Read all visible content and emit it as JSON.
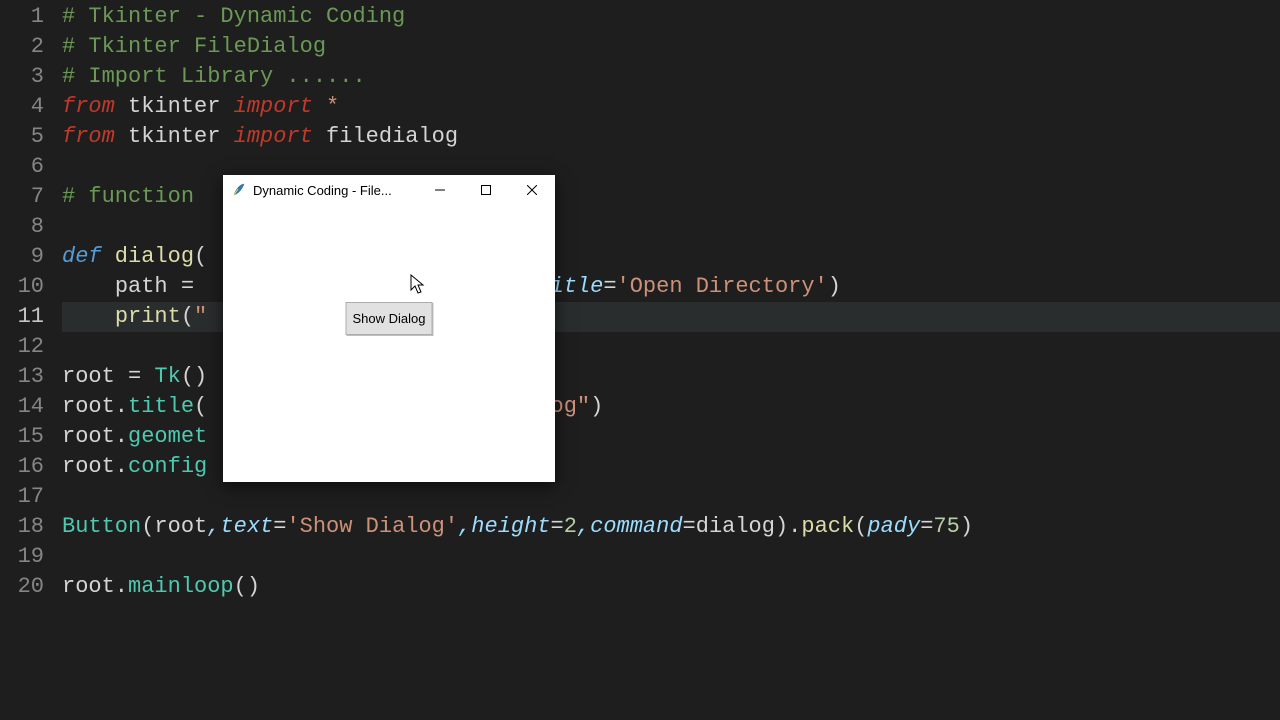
{
  "gutter": {
    "lines": [
      "1",
      "2",
      "3",
      "4",
      "5",
      "6",
      "7",
      "8",
      "9",
      "10",
      "11",
      "12",
      "13",
      "14",
      "15",
      "16",
      "17",
      "18",
      "19",
      "20"
    ],
    "active": 11
  },
  "code": {
    "l1": {
      "comment": "# Tkinter - Dynamic Coding"
    },
    "l2": {
      "comment": "# Tkinter FileDialog"
    },
    "l3": {
      "comment": "# Import Library ......"
    },
    "l4": {
      "kw1": "from",
      "mod": " tkinter ",
      "kw2": "import",
      "star": " *"
    },
    "l5": {
      "kw1": "from",
      "mod": " tkinter ",
      "kw2": "import",
      "name": " filedialog"
    },
    "l7": {
      "comment": "# function"
    },
    "l9": {
      "def": "def",
      "name": " dialog",
      "paren": "("
    },
    "l10": {
      "indent": "    ",
      "var": "path ",
      "op": "= ",
      "tail_kw": "title",
      "tail_op": "=",
      "tail_str": "'Open Directory'",
      "tail_close": ")"
    },
    "l11": {
      "indent": "    ",
      "fn": "print",
      "open": "(",
      "q": "\""
    },
    "l13": {
      "var": "root ",
      "op": "= ",
      "cls": "Tk",
      "call": "()"
    },
    "l14": {
      "obj": "root.",
      "method": "title",
      "open": "(",
      "tail_str": "alog\"",
      "close": ")"
    },
    "l15": {
      "obj": "root.",
      "method": "geomet"
    },
    "l16": {
      "obj": "root.",
      "method": "config"
    },
    "l18": {
      "cls": "Button",
      "open": "(",
      "arg0": "root",
      "p1": ",text",
      "eq1": "=",
      "s1": "'Show Dialog'",
      "p2": ",height",
      "eq2": "=",
      "n2": "2",
      "p3": ",command",
      "eq3": "=",
      "v3": "dialog",
      "close1": ").",
      "m1": "pack",
      "open2": "(",
      "p4": "pady",
      "eq4": "=",
      "n4": "75",
      "close2": ")"
    },
    "l20": {
      "obj": "root.",
      "method": "mainloop",
      "call": "()"
    }
  },
  "window": {
    "title": "Dynamic Coding - File...",
    "button_label": "Show Dialog"
  }
}
